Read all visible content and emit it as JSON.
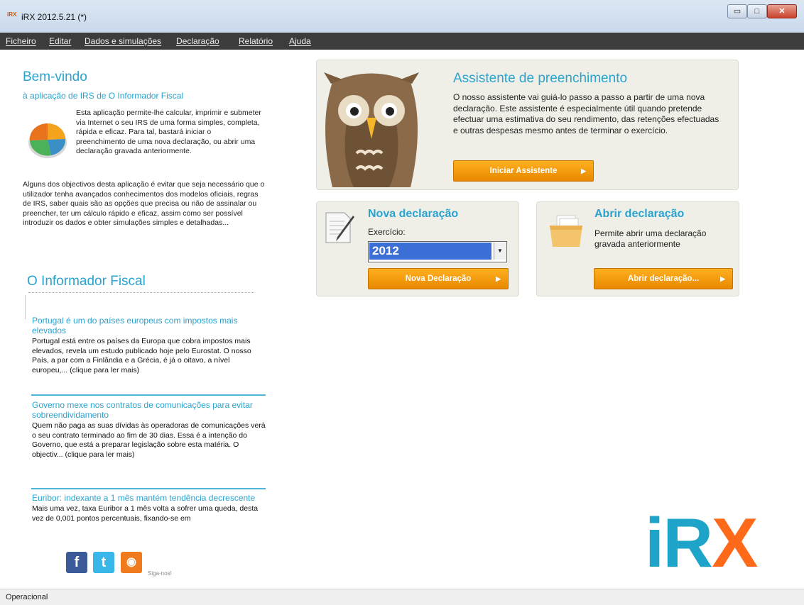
{
  "window": {
    "title": "iRX 2012.5.21 (*)",
    "min_label": "▭",
    "max_label": "□",
    "close_label": "✕"
  },
  "menu": [
    "Ficheiro",
    "Editar",
    "Dados e simulações",
    "Declaração",
    "Relatório",
    "Ajuda"
  ],
  "welcome": {
    "title": "Bem-vindo",
    "subtitle": "à aplicação de IRS de O Informador Fiscal",
    "intro": "Esta aplicação permite-lhe calcular, imprimir e submeter via Internet o seu IRS de uma forma simples, completa, rápida e eficaz. Para tal, bastará iniciar o preenchimento de uma nova declaração, ou abrir uma declaração gravada anteriormente.",
    "paragraph": "Alguns dos objectivos desta aplicação é evitar que seja necessário que o utilizador tenha avançados conhecimentos dos modelos oficiais, regras de IRS, saber quais são as opções que precisa ou não de assinalar ou preencher, ter um cálculo rápido e eficaz, assim como ser possível introduzir os dados e obter simulações simples e detalhadas..."
  },
  "informador": {
    "title": "O Informador Fiscal",
    "news": [
      {
        "title": "Portugal é um do países europeus com impostos mais elevados",
        "body": "Portugal está entre os países da Europa que cobra impostos mais elevados, revela um estudo publicado hoje pelo Eurostat. O nosso País, a par com a Finlândia e a Grécia, é já o oitavo, a nível europeu,... (clique para ler mais)"
      },
      {
        "title": "Governo mexe nos contratos de comunicações para evitar sobreendividamento",
        "body": "Quem não paga as suas dívidas às operadoras de comunicações verá o seu contrato terminado ao fim de 30 dias. Essa é a intenção do Governo, que está a preparar legislação sobre esta matéria. O objectiv... (clique para ler mais)"
      },
      {
        "title": "Euribor: indexante a 1 mês mantém tendência decrescente",
        "body": "Mais uma vez, taxa Euribor a 1 mês volta a sofrer uma queda, desta vez de 0,001 pontos percentuais, fixando-se em"
      }
    ]
  },
  "social": {
    "facebook": "f",
    "twitter": "t",
    "rss": "◉",
    "caption": "Siga-nos!"
  },
  "assistente": {
    "title": "Assistente de preenchimento",
    "text": "O nosso assistente vai guiá-lo passo a passo a partir de uma nova declaração. Este assistente é especialmente útil quando pretende efectuar uma estimativa do seu rendimento, das retenções efectuadas e outras despesas mesmo antes de terminar o exercício.",
    "button": "Iniciar Assistente"
  },
  "nova": {
    "title": "Nova declaração",
    "label": "Exercício:",
    "year": "2012",
    "button": "Nova Declaração"
  },
  "abrir": {
    "title": "Abrir declaração",
    "text": "Permite abrir uma declaração gravada anteriormente",
    "button": "Abrir declaração..."
  },
  "logo": {
    "ir": "iR",
    "x": "X"
  },
  "status": "Operacional",
  "colors": {
    "accent": "#2aa3cf",
    "button": "#f39a0b",
    "logo_x": "#ff6a1a"
  }
}
